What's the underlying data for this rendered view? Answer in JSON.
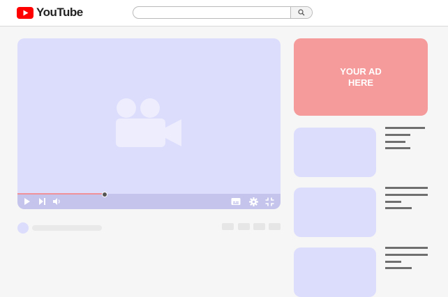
{
  "header": {
    "logo": {
      "icon": "youtube-play-logo-icon",
      "text": "YouTube",
      "color": "#ff0000"
    },
    "search": {
      "placeholder": "",
      "button_icon": "search-icon"
    }
  },
  "player": {
    "placeholder_icon": "video-camera-icon",
    "progress_played": 0.33,
    "controls": [
      "play-icon",
      "next-icon",
      "volume-icon",
      "subtitles-icon",
      "settings-icon",
      "exit-fullscreen-icon"
    ]
  },
  "ad": {
    "text": "YOUR AD\nHERE",
    "color": "#f59b9b"
  },
  "suggestions": [
    {
      "thumbnail": "video-thumbnail"
    },
    {
      "thumbnail": "video-thumbnail"
    },
    {
      "thumbnail": "video-thumbnail"
    }
  ],
  "colors": {
    "video_bg": "#dcdcfd",
    "controls_bg": "#c5c4ed",
    "progress": "#f0919a"
  }
}
